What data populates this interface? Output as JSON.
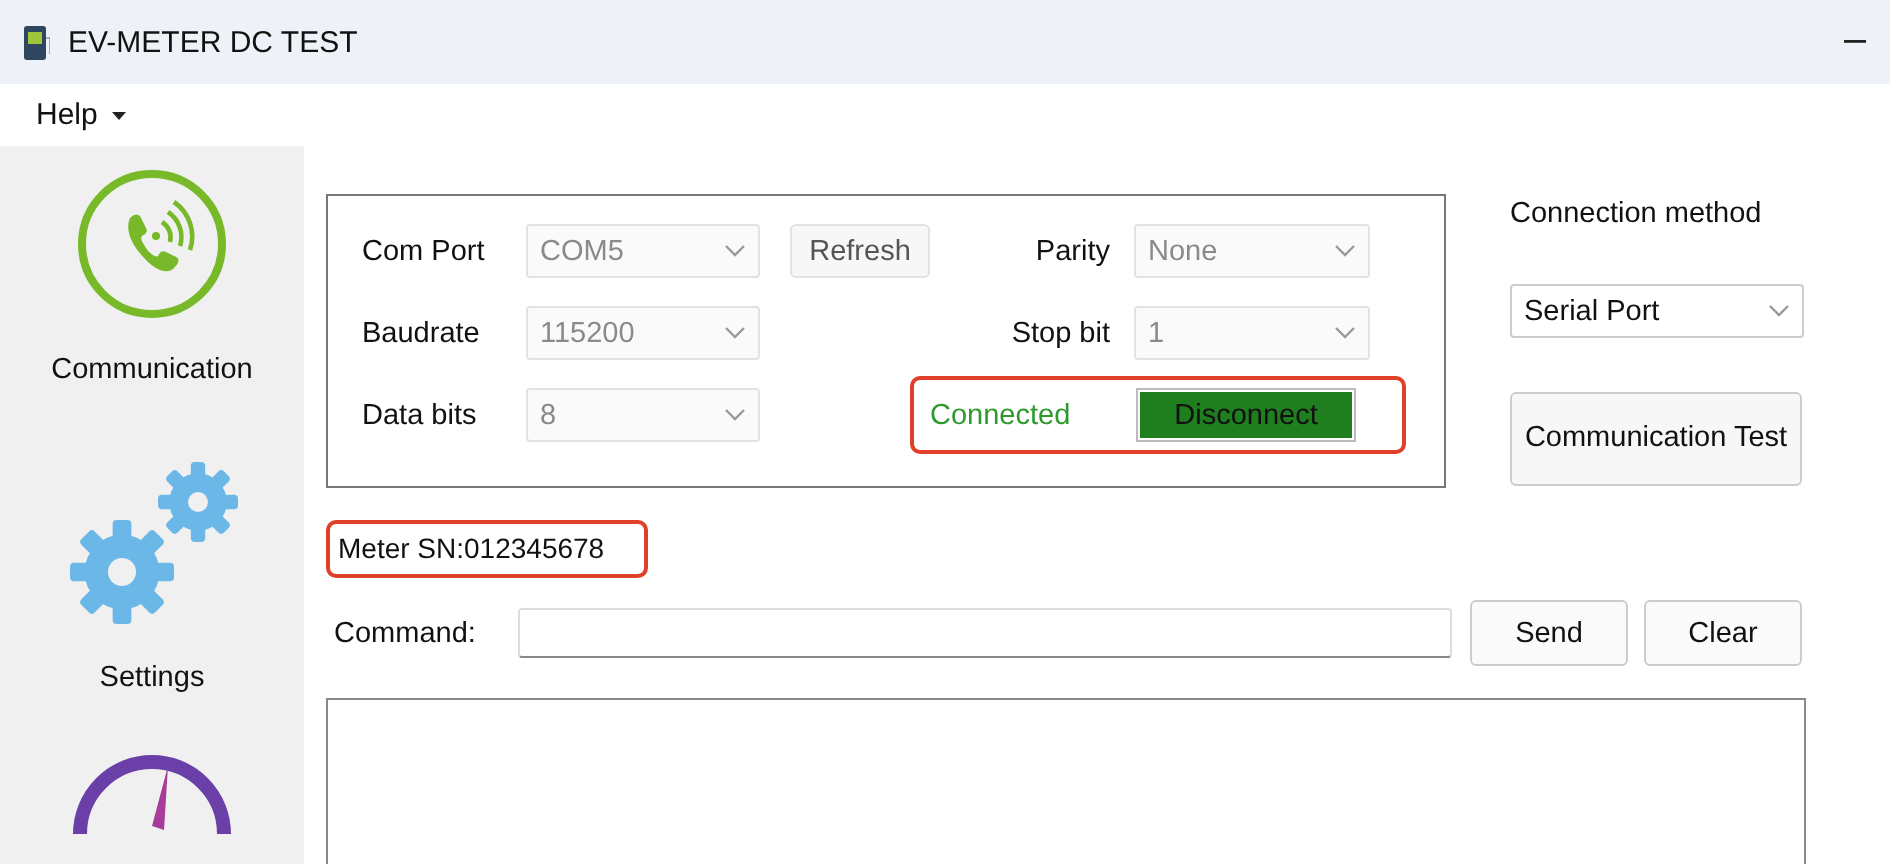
{
  "window": {
    "title": "EV-METER DC TEST"
  },
  "menu": [
    {
      "label": "Help"
    }
  ],
  "sidebar": {
    "items": [
      {
        "kind": "phone",
        "label": "Communication"
      },
      {
        "kind": "gears",
        "label": "Settings"
      },
      {
        "kind": "gauge"
      }
    ]
  },
  "connection_settings": {
    "left_fields": [
      {
        "label": "Com Port",
        "value": "COM5",
        "disabled": true
      },
      {
        "label": "Baudrate",
        "value": "115200",
        "disabled": true
      },
      {
        "label": "Data bits",
        "value": "8",
        "disabled": true
      }
    ],
    "refresh_button": "Refresh",
    "right_fields": [
      {
        "label": "Parity",
        "value": "None",
        "disabled": true
      },
      {
        "label": "Stop bit",
        "value": "1",
        "disabled": true
      }
    ],
    "status": {
      "text": "Connected",
      "connected": true
    },
    "disconnect_button": "Disconnect"
  },
  "connection_method": {
    "label": "Connection method",
    "value": "Serial Port",
    "disabled": false,
    "test_button": "Communication Test"
  },
  "meter_sn": "Meter SN:012345678",
  "command": {
    "label": "Command:",
    "buttons": [
      "Send",
      "Clear"
    ]
  }
}
